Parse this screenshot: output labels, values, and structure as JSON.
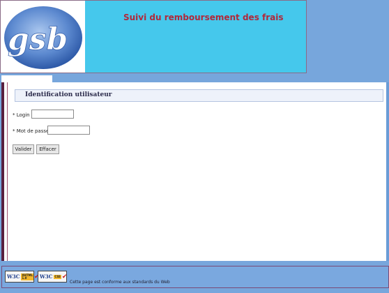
{
  "header": {
    "logo_text": "gsb",
    "title": "Suivi du remboursement des frais"
  },
  "login": {
    "section_title": "Identification utilisateur",
    "login_label": "* Login :",
    "login_value": "",
    "password_label": "* Mot de passe :",
    "password_value": "",
    "validate_label": "Valider",
    "clear_label": "Effacer"
  },
  "footer": {
    "badge_xhtml": {
      "w3c": "W3C",
      "kind_line1": "XHTML",
      "kind_line2": "1.0"
    },
    "badge_css": {
      "w3c": "W3C",
      "kind_line1": "CSS",
      "kind_line2": ""
    },
    "text": "Cette page est conforme aux standards du Web"
  },
  "colors": {
    "background": "#77a6dc",
    "header_bg": "#45c8ec",
    "title": "#b0283a"
  }
}
